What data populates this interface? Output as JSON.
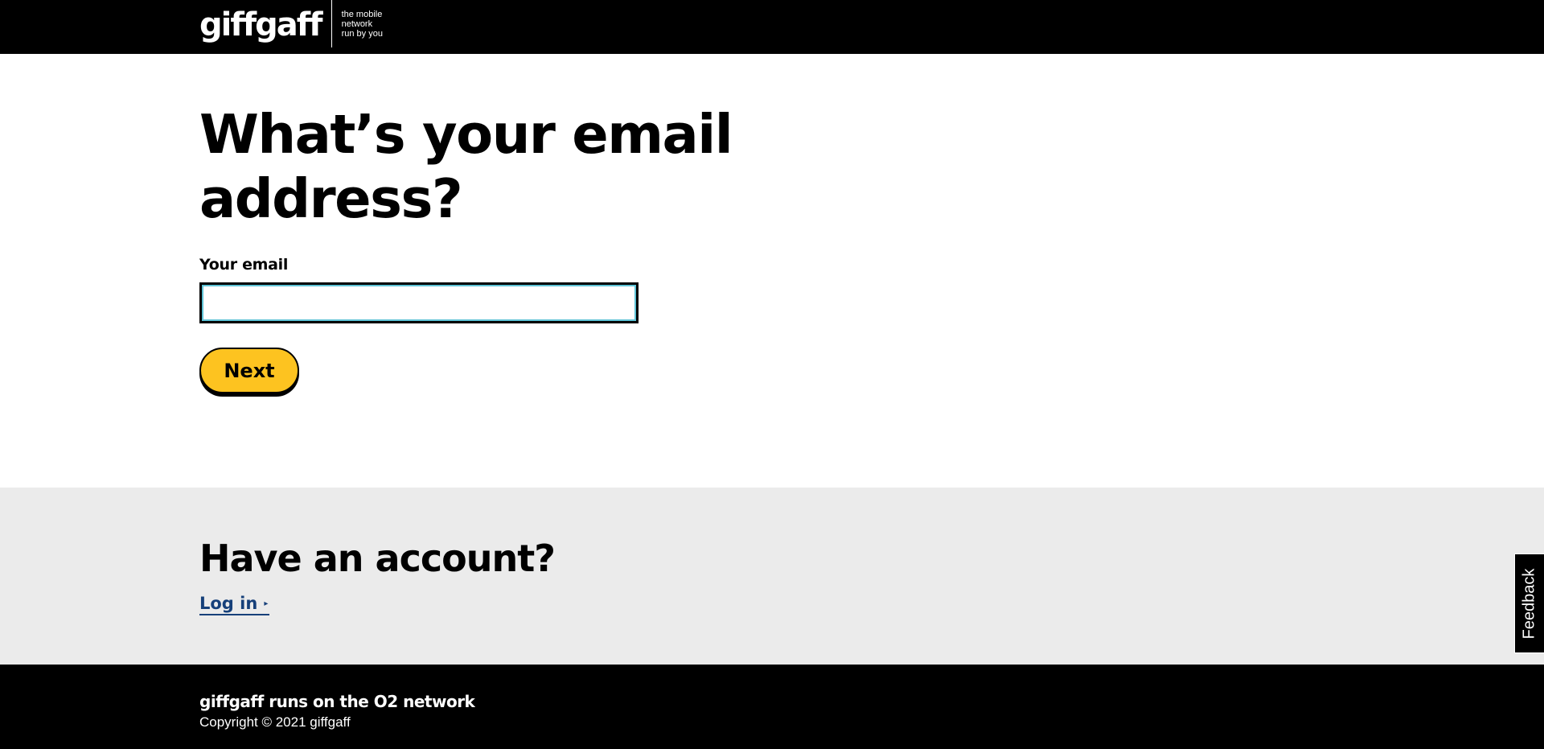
{
  "header": {
    "logo_text": "giffgaff",
    "tagline": [
      "the mobile",
      "network",
      "run by you"
    ]
  },
  "form": {
    "title": "What’s your email address?",
    "email_label": "Your email",
    "email_value": "",
    "email_placeholder": "",
    "next_label": "Next"
  },
  "account": {
    "title": "Have an account?",
    "login_label": "Log in",
    "login_arrow": "▸"
  },
  "footer": {
    "network_text": "giffgaff runs on the O2 network",
    "copyright_text": "Copyright © 2021 giffgaff"
  },
  "feedback": {
    "label": "Feedback"
  },
  "colors": {
    "brand_yellow": "#fdc320",
    "link_blue": "#16407a",
    "focus_ring": "#5fc3d6",
    "section_grey": "#ebebeb"
  }
}
